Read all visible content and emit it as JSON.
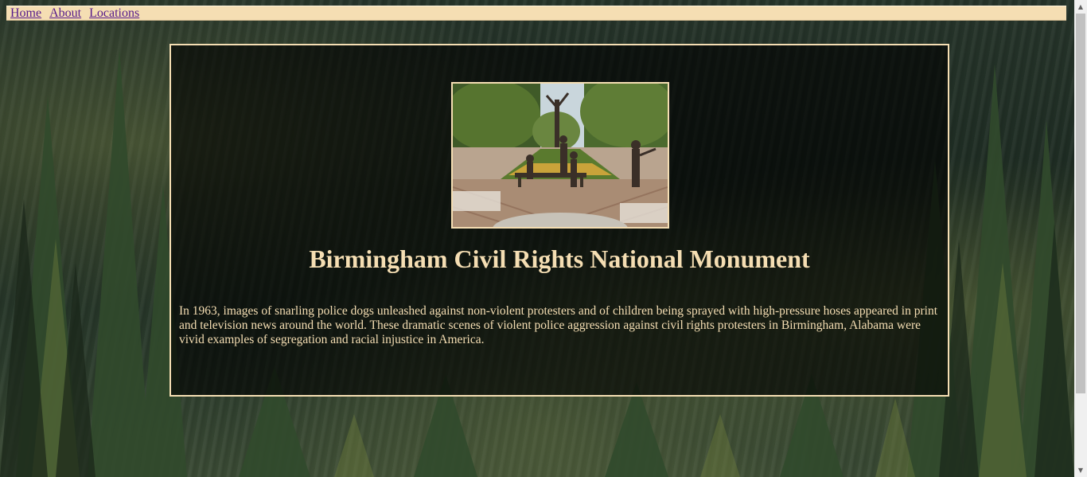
{
  "nav": {
    "links": [
      {
        "label": "Home"
      },
      {
        "label": "About"
      },
      {
        "label": "Locations"
      }
    ]
  },
  "main": {
    "title": "Birmingham Civil Rights National Monument",
    "description": "In 1963, images of snarling police dogs unleashed against non-violent protesters and of children being sprayed with high-pressure hoses appeared in print and television news around the world. These dramatic scenes of violent police aggression against civil rights protesters in Birmingham, Alabama were vivid examples of segregation and racial injustice in America."
  },
  "colors": {
    "nav_background": "#f5deb3",
    "link": "#551a8b",
    "accent_text": "#f5deb3",
    "panel_border": "#f5deb3"
  },
  "icons": {
    "scroll_up": "chevron-up-icon",
    "scroll_down": "chevron-down-icon"
  }
}
